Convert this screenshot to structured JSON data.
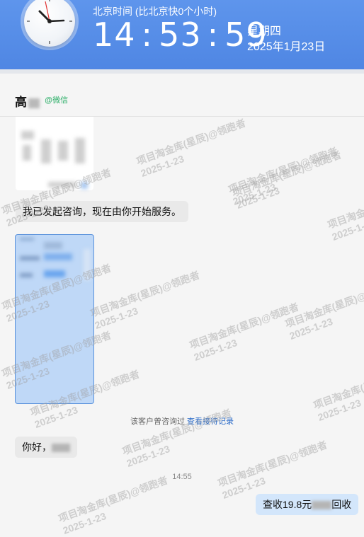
{
  "clock": {
    "timezone_label": "北京时间 (比北京快0个小时)",
    "hours": "14",
    "minutes": "53",
    "seconds": "59",
    "weekday": "星期四",
    "date": "2025年1月23日"
  },
  "chat_header": {
    "contact_name": "高",
    "source_tag": "@微信"
  },
  "messages": [
    {
      "type": "image",
      "from": "customer"
    },
    {
      "type": "text",
      "from": "customer",
      "text": "我已发起咨询，现在由你开始服务。"
    },
    {
      "type": "image",
      "from": "customer"
    },
    {
      "type": "system",
      "text": "该客户曾咨询过",
      "link": "查看接待记录"
    },
    {
      "type": "text",
      "from": "customer",
      "text": "你好，"
    },
    {
      "type": "timestamp",
      "text": "14:55"
    },
    {
      "type": "text",
      "from": "agent",
      "text_prefix": "查收19.8元",
      "text_suffix": "回收"
    }
  ],
  "watermark": {
    "line1": "项目淘金库(星辰)@领跑者",
    "line2": "2025-1-23"
  }
}
